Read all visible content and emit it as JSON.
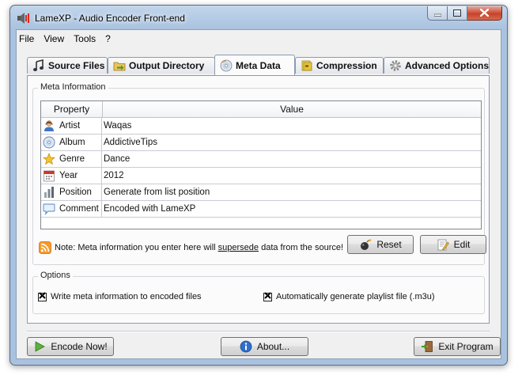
{
  "window": {
    "title": "LameXP - Audio Encoder Front-end"
  },
  "menu": [
    "File",
    "View",
    "Tools",
    "?"
  ],
  "tabs": [
    {
      "label": "Source Files",
      "icon": "music-note-icon",
      "active": false
    },
    {
      "label": "Output Directory",
      "icon": "folder-arrow-icon",
      "active": false
    },
    {
      "label": "Meta Data",
      "icon": "cd-icon",
      "active": true
    },
    {
      "label": "Compression",
      "icon": "compress-icon",
      "active": false
    },
    {
      "label": "Advanced Options",
      "icon": "gear-icon",
      "active": false
    }
  ],
  "meta": {
    "group_title": "Meta Information",
    "columns": {
      "property": "Property",
      "value": "Value"
    },
    "rows": [
      {
        "property": "Artist",
        "value": "Waqas",
        "icon": "person-icon"
      },
      {
        "property": "Album",
        "value": "AddictiveTips",
        "icon": "cd-icon"
      },
      {
        "property": "Genre",
        "value": "Dance",
        "icon": "star-icon"
      },
      {
        "property": "Year",
        "value": "2012",
        "icon": "calendar-icon"
      },
      {
        "property": "Position",
        "value": "Generate from list position",
        "icon": "bars-icon"
      },
      {
        "property": "Comment",
        "value": "Encoded with LameXP",
        "icon": "speech-bubble-icon"
      }
    ],
    "note_prefix": "Note: Meta information you enter here will ",
    "note_underline": "supersede",
    "note_suffix": " data from the source!",
    "reset_label": "Reset",
    "edit_label": "Edit"
  },
  "options": {
    "group_title": "Options",
    "write_meta_label": "Write meta information to encoded files",
    "write_meta_checked": true,
    "playlist_label": "Automatically generate playlist file (.m3u)",
    "playlist_checked": true
  },
  "footer": {
    "encode_label": "Encode Now!",
    "about_label": "About...",
    "exit_label": "Exit Program"
  },
  "colors": {
    "accent": "#3a8a2a",
    "info": "#2f6fcb",
    "close": "#c7432b"
  }
}
